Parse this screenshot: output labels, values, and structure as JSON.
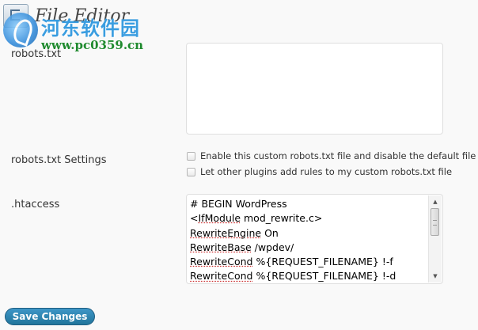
{
  "header": {
    "title": "File Editor",
    "icon": "file-editor-icon"
  },
  "watermark": {
    "text_cn": "河东软件园",
    "url": "www.pc0359.cn"
  },
  "robots_txt": {
    "label": "robots.txt",
    "value": ""
  },
  "robots_settings": {
    "label": "robots.txt Settings",
    "options": [
      {
        "label": "Enable this custom robots.txt file and disable the default file",
        "checked": false
      },
      {
        "label": "Let other plugins add rules to my custom robots.txt file",
        "checked": false
      }
    ]
  },
  "htaccess": {
    "label": ".htaccess",
    "lines": [
      "# BEGIN WordPress",
      "<IfModule mod_rewrite.c>",
      "RewriteEngine On",
      "RewriteBase /wpdev/",
      "RewriteCond %{REQUEST_FILENAME} !-f",
      "RewriteCond %{REQUEST_FILENAME} !-d"
    ]
  },
  "actions": {
    "save_label": "Save Changes"
  },
  "colors": {
    "page_background": "#f9f9f9",
    "primary_button": "#21759b",
    "watermark_blue": "#3a9de0",
    "watermark_green": "#1f8a2e"
  }
}
